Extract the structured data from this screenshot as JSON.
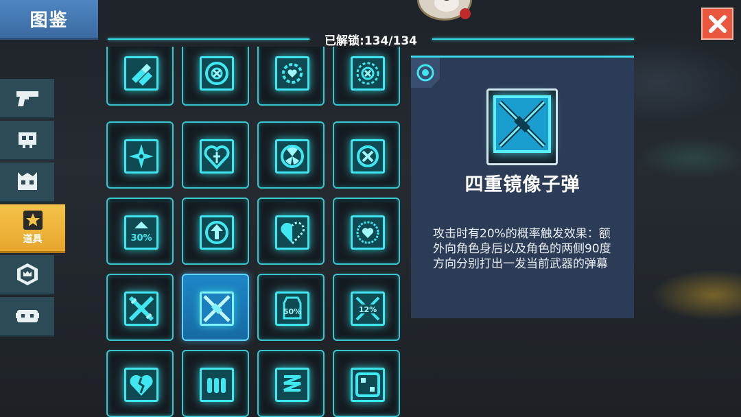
{
  "header": {
    "title": "图鉴",
    "unlock_text": "已解锁:134/134"
  },
  "sidebar": {
    "tabs": [
      {
        "icon": "gun-icon",
        "label": ""
      },
      {
        "icon": "skull-icon",
        "label": ""
      },
      {
        "icon": "boss-icon",
        "label": ""
      },
      {
        "icon": "star-icon",
        "label": "道具",
        "active": true
      },
      {
        "icon": "crown-badge-icon",
        "label": ""
      },
      {
        "icon": "pet-icon",
        "label": ""
      }
    ]
  },
  "grid": {
    "items": [
      {
        "icon": "bullets-icon"
      },
      {
        "icon": "crosshair-target-icon"
      },
      {
        "icon": "sun-heart-icon"
      },
      {
        "icon": "dotted-target-icon"
      },
      {
        "icon": "shuriken-icon"
      },
      {
        "icon": "holy-heart-icon"
      },
      {
        "icon": "radiation-icon"
      },
      {
        "icon": "cross-circle-icon"
      },
      {
        "icon": "up-30-icon",
        "text": "30%"
      },
      {
        "icon": "arrow-circle-icon"
      },
      {
        "icon": "half-heart-icon"
      },
      {
        "icon": "heart-clock-icon"
      },
      {
        "icon": "cross-swords-icon"
      },
      {
        "icon": "mirror-bullet-icon",
        "selected": true
      },
      {
        "icon": "shield-50-icon",
        "text": "50%"
      },
      {
        "icon": "cross-12-icon",
        "text": "12%"
      },
      {
        "icon": "broken-heart-icon"
      },
      {
        "icon": "ammo-clip-icon"
      },
      {
        "icon": "spring-icon"
      },
      {
        "icon": "dice-icon"
      }
    ]
  },
  "detail": {
    "name": "四重镜像子弹",
    "description": "攻击时有20%的概率触发效果：额外向角色身后以及角色的两侧90度方向分别打出一发当前武器的弹幕"
  },
  "colors": {
    "accent_cyan": "#3fe8f1",
    "selected_blue": "#1e86c6",
    "active_tab": "#f5c34a",
    "close_red": "#e9573f"
  }
}
